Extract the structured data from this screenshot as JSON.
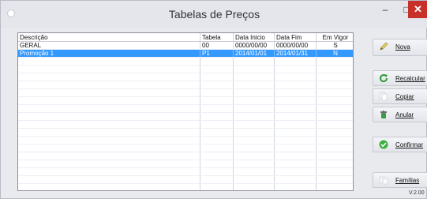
{
  "window": {
    "title": "Tabelas de Preços",
    "minimize": "–",
    "maximize": "□",
    "close": "✕"
  },
  "table": {
    "columns": [
      "Descrição",
      "Tabela",
      "Data Inicio",
      "Data Fim",
      "Em Vigor"
    ],
    "rows": [
      [
        "GERAL",
        "00",
        "0000/00/00",
        "0000/00/00",
        "S"
      ],
      [
        "Promoção 1",
        "P1",
        "2014/01/01",
        "2014/01/31",
        "N"
      ]
    ],
    "selected_row": 1
  },
  "buttons": {
    "nova": {
      "label": "Nova",
      "icon": "pencil-icon"
    },
    "recalcular": {
      "label": "Recalcular",
      "icon": "refresh-icon"
    },
    "copiar": {
      "label": "Copiar",
      "icon": "copy-icon"
    },
    "anular": {
      "label": "Anular",
      "icon": "trash-icon"
    },
    "confirmar": {
      "label": "Confirmar",
      "icon": "check-icon"
    },
    "familias": {
      "label": "Famílias",
      "icon": "folders-icon"
    }
  },
  "version": "V.2.00",
  "colors": {
    "selection": "#3399ff",
    "close": "#c7312a",
    "confirm": "#3fae3f"
  }
}
